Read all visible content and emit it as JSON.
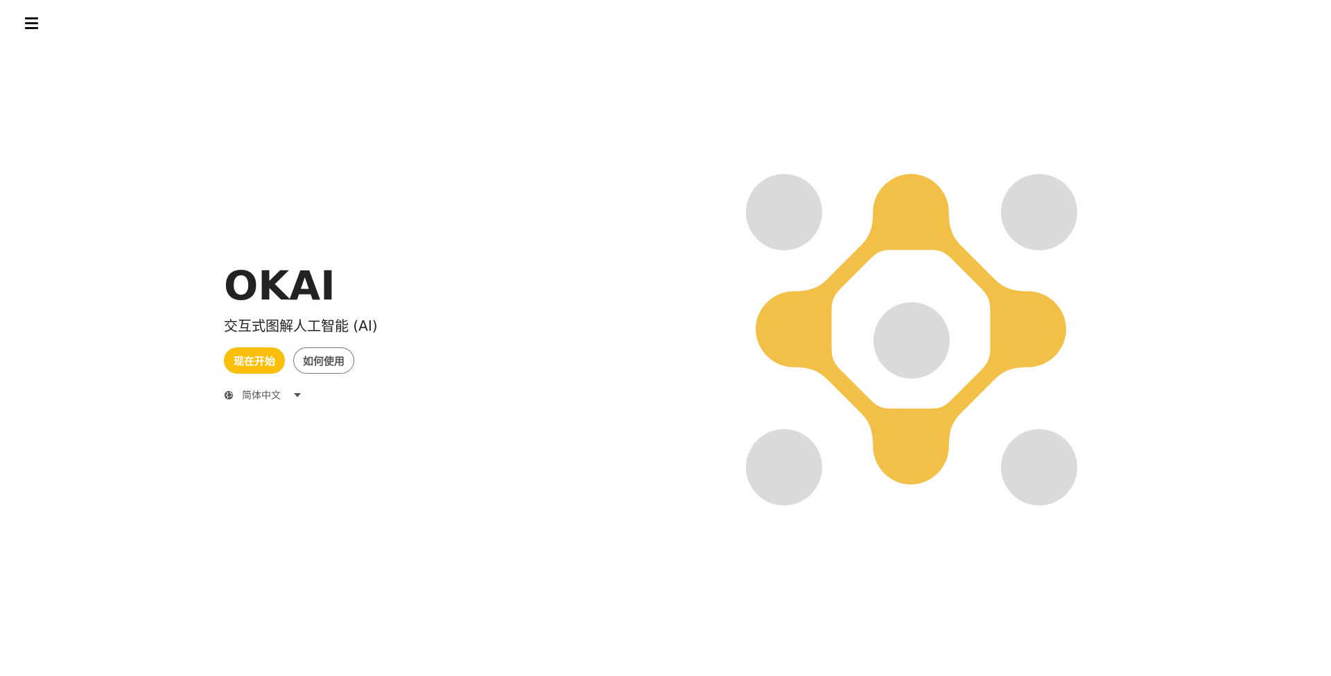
{
  "header": {
    "menu_icon": "hamburger-menu-icon"
  },
  "hero": {
    "title": "OKAI",
    "subtitle": "交互式图解人工智能 (AI)",
    "primary_button": "现在开始",
    "secondary_button": "如何使用",
    "language": {
      "icon": "globe-icon",
      "selected": "简体中文",
      "dropdown_icon": "caret-down-icon"
    }
  },
  "logo": {
    "icon": "okai-logo",
    "accent_color": "#f3c047",
    "neutral_color": "#dadada",
    "button_color": "#f9bf0b"
  }
}
